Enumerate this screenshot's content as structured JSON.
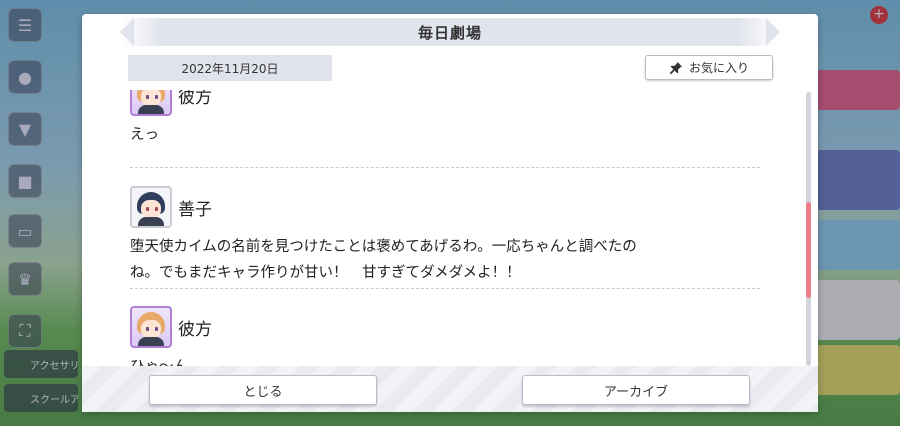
{
  "modal": {
    "title": "毎日劇場",
    "date": "2022年11月20日",
    "favorite_label": "お気に入り",
    "scroll_position": 0.62
  },
  "messages": [
    {
      "speaker": "彼方",
      "avatar": "kanata-avatar",
      "text": "えっ"
    },
    {
      "speaker": "善子",
      "avatar": "yoshiko-avatar",
      "text_line1": "堕天使カイムの名前を見つけたことは褒めてあげるわ。一応ちゃんと調べたの",
      "text_line2": "ね。でもまだキャラ作りが甘い！　甘すぎてダメダメよ！！"
    },
    {
      "speaker": "彼方",
      "avatar": "kanata-avatar",
      "text": "ひゃ～ん……"
    }
  ],
  "footer": {
    "close_label": "とじる",
    "archive_label": "アーカイブ"
  },
  "background": {
    "left_labels": [
      "アクセサリー",
      "スクールアイドル"
    ]
  },
  "colors": {
    "scroll_thumb": "#ef7c8a",
    "header_bg": "#e1e4ec",
    "kanata_frame": "#b07fd8"
  }
}
